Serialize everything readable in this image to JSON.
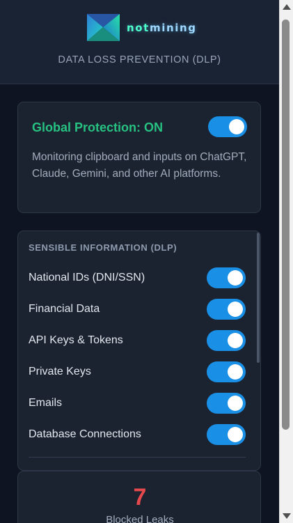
{
  "header": {
    "brand_prefix": "not",
    "brand_suffix": "mining",
    "subtitle": "DATA LOSS PREVENTION (DLP)"
  },
  "global": {
    "title": "Global Protection: ON",
    "description": "Monitoring clipboard and inputs on ChatGPT, Claude, Gemini, and other AI platforms.",
    "enabled": true
  },
  "sensible": {
    "title": "SENSIBLE INFORMATION (DLP)",
    "items": [
      {
        "label": "National IDs (DNI/SSN)",
        "enabled": true
      },
      {
        "label": "Financial Data",
        "enabled": true
      },
      {
        "label": "API Keys & Tokens",
        "enabled": true
      },
      {
        "label": "Private Keys",
        "enabled": true
      },
      {
        "label": "Emails",
        "enabled": true
      },
      {
        "label": "Database Connections",
        "enabled": true
      }
    ]
  },
  "stats": {
    "blocked_count": "7",
    "blocked_label": "Blocked Leaks"
  },
  "colors": {
    "accent": "#1a8fe6",
    "success": "#27c281",
    "danger": "#e5484d"
  }
}
